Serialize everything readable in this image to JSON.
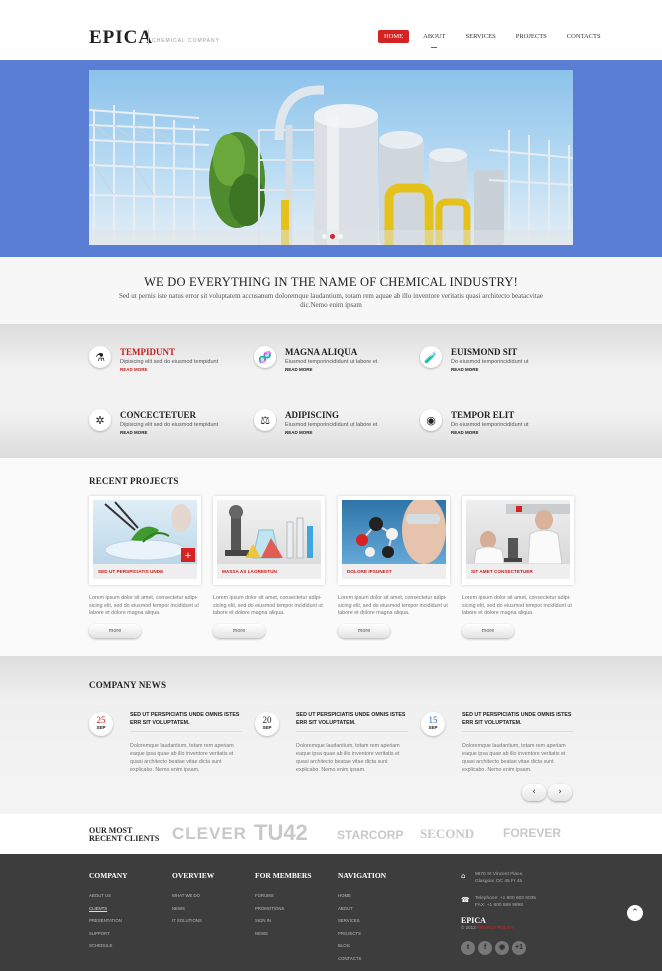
{
  "header": {
    "logo": "EPICA",
    "tagline": "CHEMICAL COMPANY",
    "nav": [
      {
        "label": "HOME",
        "active": true
      },
      {
        "label": "ABOUT",
        "active": false
      },
      {
        "label": "SERVICES",
        "active": false
      },
      {
        "label": "PROJECTS",
        "active": false
      },
      {
        "label": "CONTACTS",
        "active": false
      }
    ]
  },
  "hero": {
    "slide_count": 3,
    "active_slide": 1
  },
  "headline": {
    "title": "WE DO EVERYTHING IN THE NAME OF CHEMICAL INDUSTRY!",
    "text": "Sed ut pernis iste natus error sit voluptatem accusanum doloremque laudantium, totam rem aquae ab illo inventore veritatis quasi architecto beatacvitae dic.Nemo enim ipsam"
  },
  "features": [
    {
      "title": "TEMPIDUNT",
      "text": "Dipisicing elit sed do eiusmod tempidunt",
      "more": "READ MORE",
      "icon": "microscope-icon",
      "glyph": "⚗",
      "highlight": true
    },
    {
      "title": "MAGNA ALIQUA",
      "text": "Eiusmod temporincididunt ut labore et",
      "more": "READ MORE",
      "icon": "dna-icon",
      "glyph": "🧬",
      "highlight": false
    },
    {
      "title": "EUISMOND SIT",
      "text": "Do eiusmod temporincididunt ut",
      "more": "READ MORE",
      "icon": "test-tubes-icon",
      "glyph": "🧪",
      "highlight": false
    },
    {
      "title": "CONCECTETUER",
      "text": "Dipisicing elit sed do eiusmod tempidunt",
      "more": "READ MORE",
      "icon": "molecule-icon",
      "glyph": "✲",
      "highlight": false
    },
    {
      "title": "ADIPISCING",
      "text": "Eiusmod temporincididunt ut labore et",
      "more": "READ MORE",
      "icon": "lab-flask-icon",
      "glyph": "⚖",
      "highlight": false
    },
    {
      "title": "TEMPOR ELIT",
      "text": "Do eiusmod temporincididunt ut",
      "more": "READ MORE",
      "icon": "disc-icon",
      "glyph": "◉",
      "highlight": false
    }
  ],
  "projects": {
    "title": "RECENT PROJECTS",
    "items": [
      {
        "caption": "SED UT PERSPICIATIS UNDE",
        "text": "Lorem ipsum dolor sit amet, consectetur adipi-sicing elit, sed do eiusmod tempor incididunt ut labore et dolore magna aliqua.",
        "button": "more"
      },
      {
        "caption": "MASSA AS LAOREETUN",
        "text": "Lorem ipsum dolor sit amet, consectetur adipi-sicing elit, sed do eiusmod tempor incididunt ut labore et dolore magna aliqua.",
        "button": "more"
      },
      {
        "caption": "DOLORE IPSUNEST",
        "text": "Lorem ipsum dolor sit amet, consectetur adipi-sicing elit, sed do eiusmod tempor incididunt ut labore et dolore magna aliqua.",
        "button": "more"
      },
      {
        "caption": "SIT AMET CONSECTETUER",
        "text": "Lorem ipsum dolor sit amet, consectetur adipi-sicing elit, sed do eiusmod tempor incididunt ut labore et dolore magna aliqua.",
        "button": "more"
      }
    ]
  },
  "news": {
    "title": "COMPANY NEWS",
    "items": [
      {
        "day": "25",
        "month": "SEP",
        "headline": "SED UT PERSPICIATIS UNDE OMNIS ISTES ERR SIT VOLUPTATEM.",
        "text": "Doloremque laudantium, totam rem aperiam eaque ipsa quae ab illo inventore veritatis et quasi architecto beatae vitae dicta sunt explicabo. Nemo enim ipsam."
      },
      {
        "day": "20",
        "month": "SEP",
        "headline": "SED UT PERSPICIATIS UNDE OMNIS ISTES ERR SIT VOLUPTATEM.",
        "text": "Doloremque laudantium, totam rem aperiam eaque ipsa quae ab illo inventore veritatis et quasi architecto beatae vitae dicta sunt explicabo. Nemo enim ipsam."
      },
      {
        "day": "15",
        "month": "SEP",
        "headline": "SED UT PERSPICIATIS UNDE OMNIS ISTES ERR SIT VOLUPTATEM.",
        "text": "Doloremque laudantium, totam rem aperiam eaque ipsa quae ab illo inventore veritatis et quasi architecto beatae vitae dicta sunt explicabo. Nemo enim ipsam."
      }
    ],
    "prev": "‹",
    "next": "›"
  },
  "clients": {
    "title_line1": "OUR MOST",
    "title_line2": "RECENT CLIENTS",
    "logos": [
      "CLEVER",
      "TU42",
      "STARCORP",
      "SECOND",
      "FOREVER"
    ]
  },
  "footer": {
    "columns": [
      {
        "title": "COMPANY",
        "links": [
          "ABOUT US",
          "CLIENTS",
          "PRESENTATION",
          "SUPPORT",
          "SCHEDULE"
        ],
        "underlined": 1
      },
      {
        "title": "OVERVIEW",
        "links": [
          "WHAT WE DO",
          "NEWS",
          "IT SOLUTIONS"
        ],
        "underlined": -1
      },
      {
        "title": "FOR MEMBERS",
        "links": [
          "FORUMS",
          "PROMOTIONS",
          "SIGN IN",
          "NEWS"
        ],
        "underlined": -1
      },
      {
        "title": "NAVIGATION",
        "links": [
          "HOME",
          "ABOUT",
          "SERVICES",
          "PROJECTS",
          "BLOG",
          "CONTACTS"
        ],
        "underlined": -1
      }
    ],
    "address_line1": "9870 St Vincent Place,",
    "address_line2": "Glasgow, DC 45 Fr 45",
    "telephone": "Telephone: +1 800 603 6035",
    "fax": "FAX:         +1 800 889 9898",
    "brand": "EPICA",
    "copyright": "© 2013",
    "privacy": "PRIVACY POLICY",
    "social": [
      {
        "name": "twitter-icon",
        "glyph": "t"
      },
      {
        "name": "facebook-icon",
        "glyph": "f"
      },
      {
        "name": "rss-icon",
        "glyph": "◉"
      },
      {
        "name": "google-plus-icon",
        "glyph": "+1"
      }
    ],
    "to_top": "⌃"
  },
  "colors": {
    "accent": "#d52222",
    "hero_bg": "#5a7ed4",
    "footer_bg": "#3d3d3d"
  }
}
